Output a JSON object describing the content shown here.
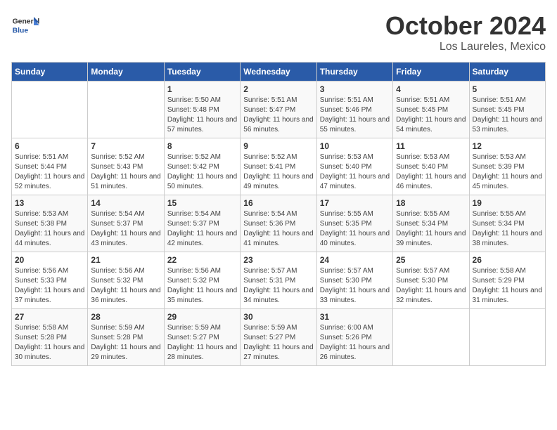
{
  "logo": {
    "general": "General",
    "blue": "Blue"
  },
  "title": "October 2024",
  "location": "Los Laureles, Mexico",
  "days_header": [
    "Sunday",
    "Monday",
    "Tuesday",
    "Wednesday",
    "Thursday",
    "Friday",
    "Saturday"
  ],
  "weeks": [
    [
      {
        "day": "",
        "info": ""
      },
      {
        "day": "",
        "info": ""
      },
      {
        "day": "1",
        "info": "Sunrise: 5:50 AM\nSunset: 5:48 PM\nDaylight: 11 hours and 57 minutes."
      },
      {
        "day": "2",
        "info": "Sunrise: 5:51 AM\nSunset: 5:47 PM\nDaylight: 11 hours and 56 minutes."
      },
      {
        "day": "3",
        "info": "Sunrise: 5:51 AM\nSunset: 5:46 PM\nDaylight: 11 hours and 55 minutes."
      },
      {
        "day": "4",
        "info": "Sunrise: 5:51 AM\nSunset: 5:45 PM\nDaylight: 11 hours and 54 minutes."
      },
      {
        "day": "5",
        "info": "Sunrise: 5:51 AM\nSunset: 5:45 PM\nDaylight: 11 hours and 53 minutes."
      }
    ],
    [
      {
        "day": "6",
        "info": "Sunrise: 5:51 AM\nSunset: 5:44 PM\nDaylight: 11 hours and 52 minutes."
      },
      {
        "day": "7",
        "info": "Sunrise: 5:52 AM\nSunset: 5:43 PM\nDaylight: 11 hours and 51 minutes."
      },
      {
        "day": "8",
        "info": "Sunrise: 5:52 AM\nSunset: 5:42 PM\nDaylight: 11 hours and 50 minutes."
      },
      {
        "day": "9",
        "info": "Sunrise: 5:52 AM\nSunset: 5:41 PM\nDaylight: 11 hours and 49 minutes."
      },
      {
        "day": "10",
        "info": "Sunrise: 5:53 AM\nSunset: 5:40 PM\nDaylight: 11 hours and 47 minutes."
      },
      {
        "day": "11",
        "info": "Sunrise: 5:53 AM\nSunset: 5:40 PM\nDaylight: 11 hours and 46 minutes."
      },
      {
        "day": "12",
        "info": "Sunrise: 5:53 AM\nSunset: 5:39 PM\nDaylight: 11 hours and 45 minutes."
      }
    ],
    [
      {
        "day": "13",
        "info": "Sunrise: 5:53 AM\nSunset: 5:38 PM\nDaylight: 11 hours and 44 minutes."
      },
      {
        "day": "14",
        "info": "Sunrise: 5:54 AM\nSunset: 5:37 PM\nDaylight: 11 hours and 43 minutes."
      },
      {
        "day": "15",
        "info": "Sunrise: 5:54 AM\nSunset: 5:37 PM\nDaylight: 11 hours and 42 minutes."
      },
      {
        "day": "16",
        "info": "Sunrise: 5:54 AM\nSunset: 5:36 PM\nDaylight: 11 hours and 41 minutes."
      },
      {
        "day": "17",
        "info": "Sunrise: 5:55 AM\nSunset: 5:35 PM\nDaylight: 11 hours and 40 minutes."
      },
      {
        "day": "18",
        "info": "Sunrise: 5:55 AM\nSunset: 5:34 PM\nDaylight: 11 hours and 39 minutes."
      },
      {
        "day": "19",
        "info": "Sunrise: 5:55 AM\nSunset: 5:34 PM\nDaylight: 11 hours and 38 minutes."
      }
    ],
    [
      {
        "day": "20",
        "info": "Sunrise: 5:56 AM\nSunset: 5:33 PM\nDaylight: 11 hours and 37 minutes."
      },
      {
        "day": "21",
        "info": "Sunrise: 5:56 AM\nSunset: 5:32 PM\nDaylight: 11 hours and 36 minutes."
      },
      {
        "day": "22",
        "info": "Sunrise: 5:56 AM\nSunset: 5:32 PM\nDaylight: 11 hours and 35 minutes."
      },
      {
        "day": "23",
        "info": "Sunrise: 5:57 AM\nSunset: 5:31 PM\nDaylight: 11 hours and 34 minutes."
      },
      {
        "day": "24",
        "info": "Sunrise: 5:57 AM\nSunset: 5:30 PM\nDaylight: 11 hours and 33 minutes."
      },
      {
        "day": "25",
        "info": "Sunrise: 5:57 AM\nSunset: 5:30 PM\nDaylight: 11 hours and 32 minutes."
      },
      {
        "day": "26",
        "info": "Sunrise: 5:58 AM\nSunset: 5:29 PM\nDaylight: 11 hours and 31 minutes."
      }
    ],
    [
      {
        "day": "27",
        "info": "Sunrise: 5:58 AM\nSunset: 5:28 PM\nDaylight: 11 hours and 30 minutes."
      },
      {
        "day": "28",
        "info": "Sunrise: 5:59 AM\nSunset: 5:28 PM\nDaylight: 11 hours and 29 minutes."
      },
      {
        "day": "29",
        "info": "Sunrise: 5:59 AM\nSunset: 5:27 PM\nDaylight: 11 hours and 28 minutes."
      },
      {
        "day": "30",
        "info": "Sunrise: 5:59 AM\nSunset: 5:27 PM\nDaylight: 11 hours and 27 minutes."
      },
      {
        "day": "31",
        "info": "Sunrise: 6:00 AM\nSunset: 5:26 PM\nDaylight: 11 hours and 26 minutes."
      },
      {
        "day": "",
        "info": ""
      },
      {
        "day": "",
        "info": ""
      }
    ]
  ]
}
